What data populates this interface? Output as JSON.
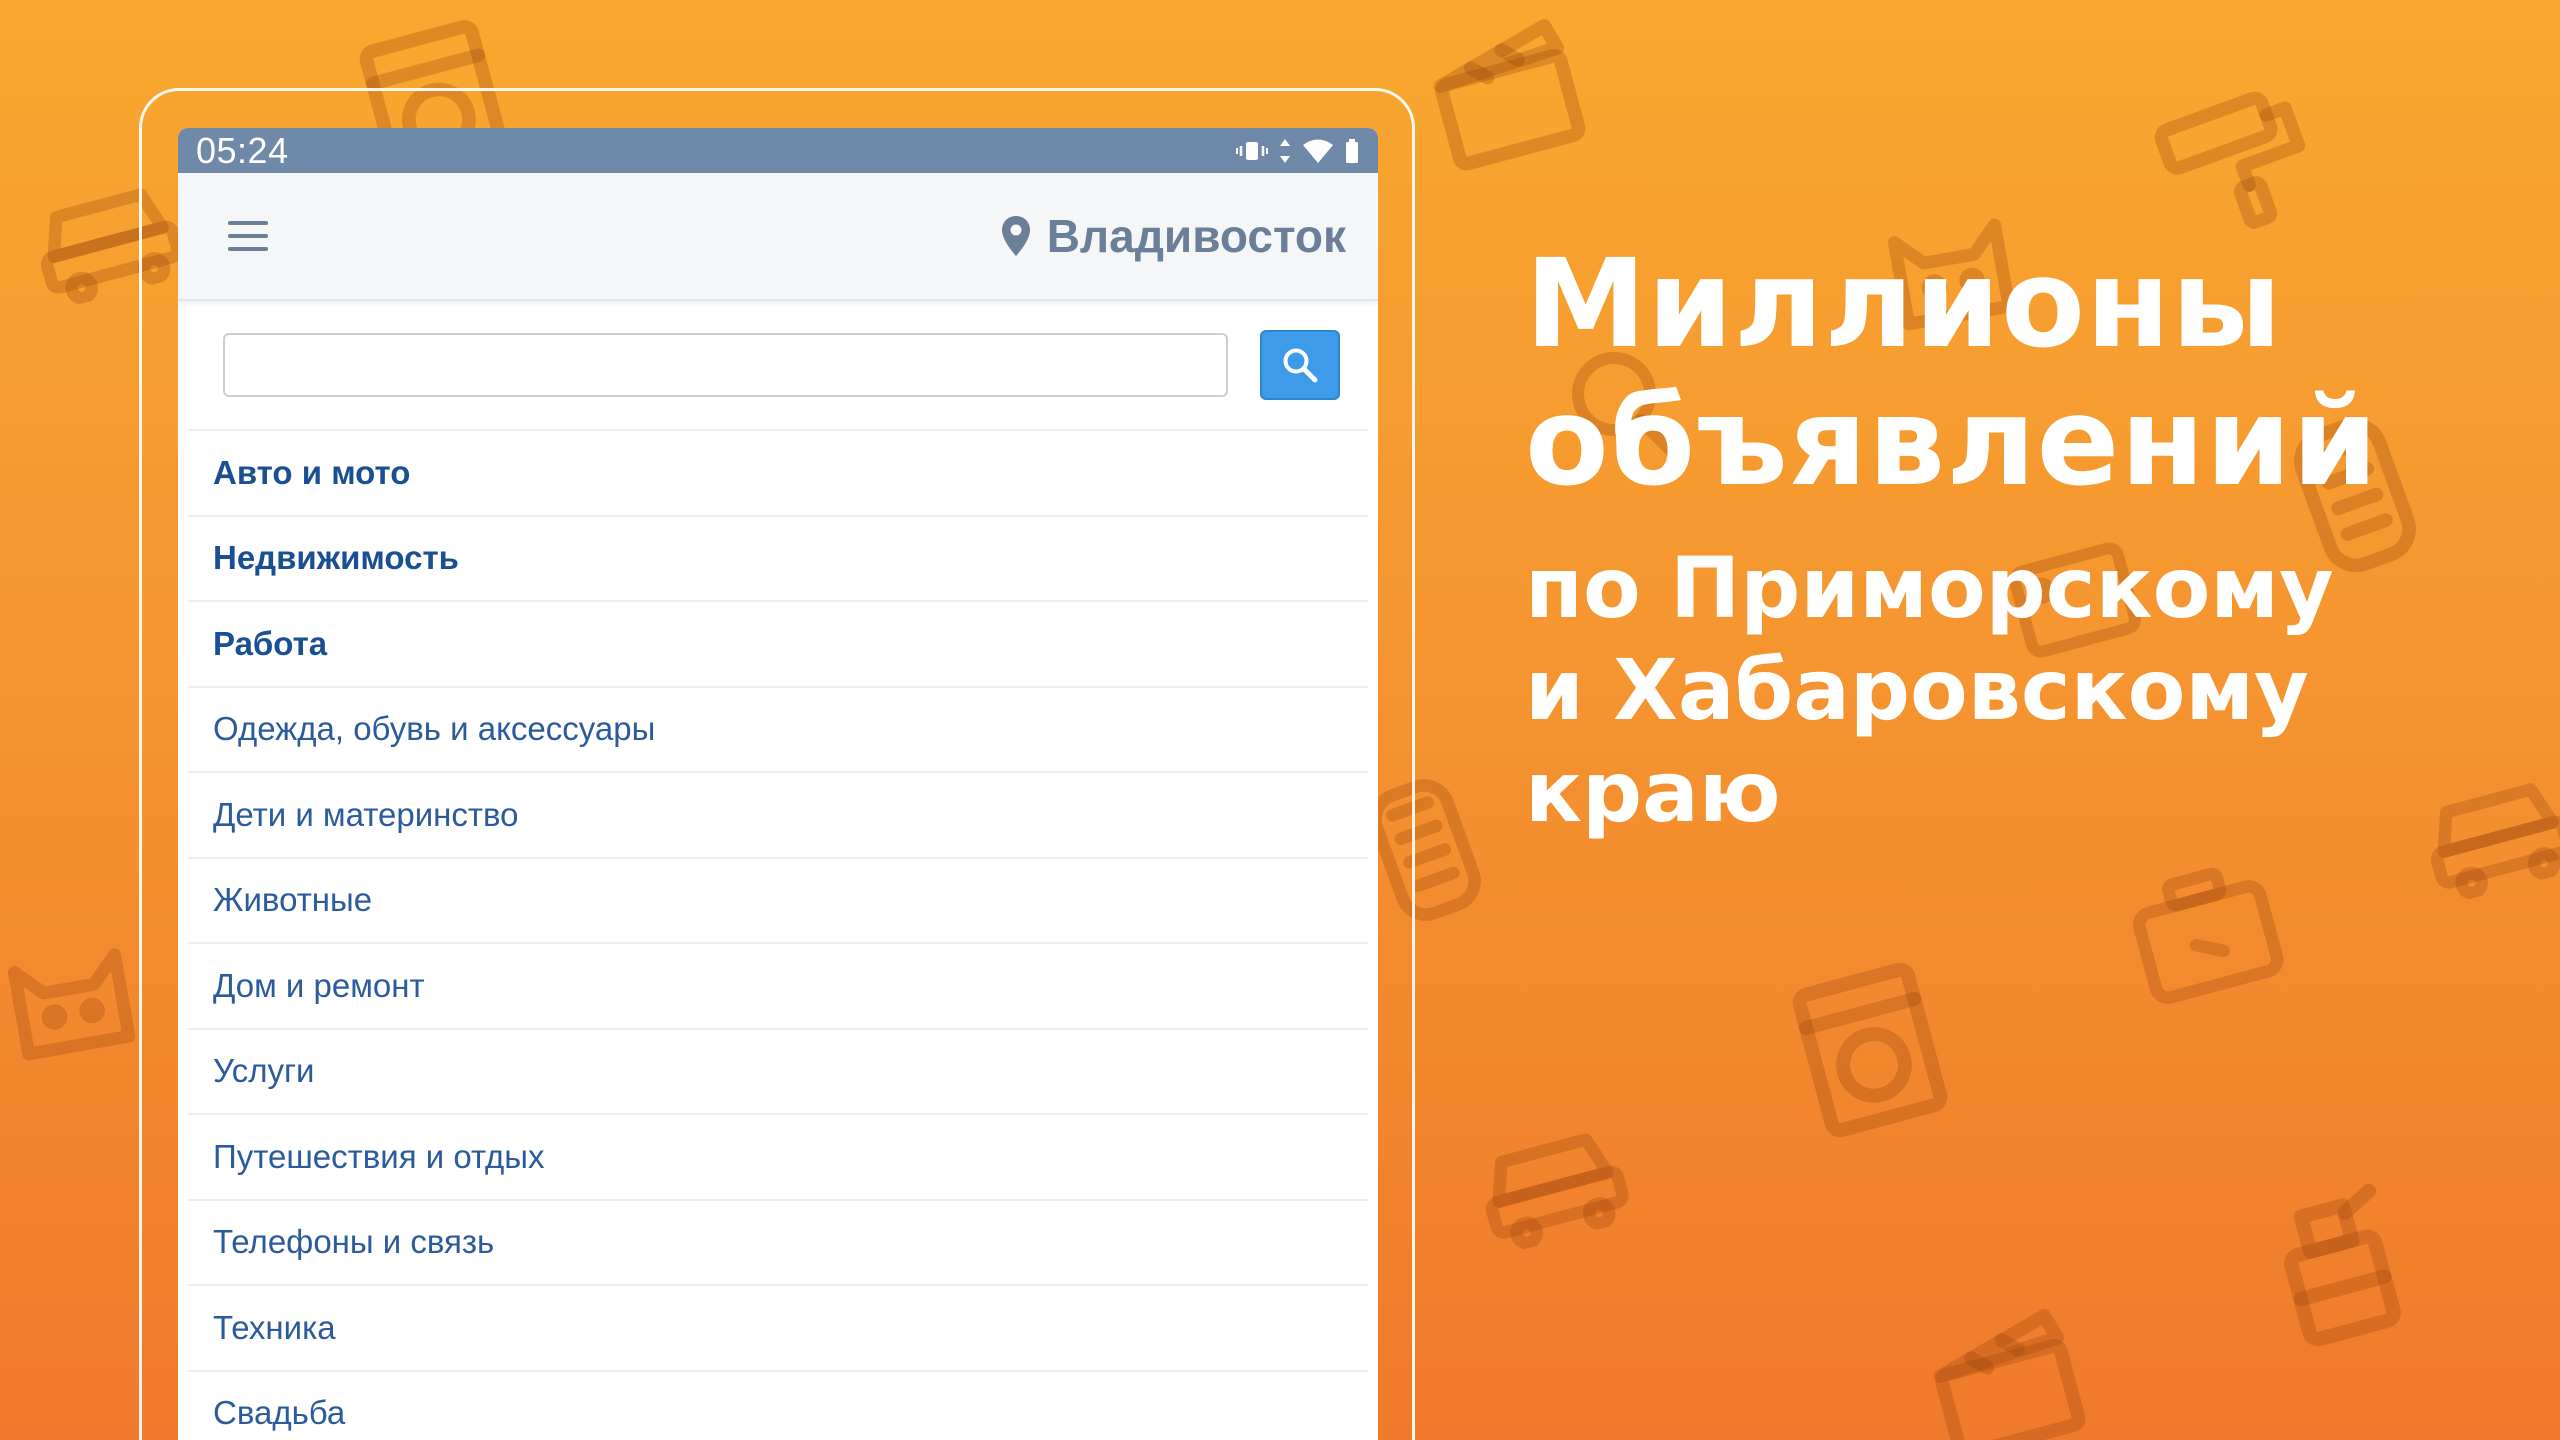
{
  "status_bar": {
    "time": "05:24",
    "icons": [
      "vibrate-icon",
      "data-arrows-icon",
      "wifi-icon",
      "battery-icon"
    ]
  },
  "app_bar": {
    "menu_icon": "hamburger-menu-icon",
    "location_icon": "map-pin-icon",
    "location": "Владивосток"
  },
  "search": {
    "value": "",
    "placeholder": "",
    "button_icon": "search-icon"
  },
  "categories": [
    {
      "label": "Авто и мото",
      "bold": true
    },
    {
      "label": "Недвижимость",
      "bold": true
    },
    {
      "label": "Работа",
      "bold": true
    },
    {
      "label": "Одежда, обувь и аксессуары",
      "bold": false
    },
    {
      "label": "Дети и материнство",
      "bold": false
    },
    {
      "label": "Животные",
      "bold": false
    },
    {
      "label": "Дом и ремонт",
      "bold": false
    },
    {
      "label": "Услуги",
      "bold": false
    },
    {
      "label": "Путешествия и отдых",
      "bold": false
    },
    {
      "label": "Телефоны и связь",
      "bold": false
    },
    {
      "label": "Техника",
      "bold": false
    },
    {
      "label": "Свадьба",
      "bold": false
    }
  ],
  "headline": {
    "title_line1": "Миллионы",
    "title_line2": "объявлений",
    "sub_line1": "по Приморскому",
    "sub_line2": "и Хабаровскому",
    "sub_line3": "краю"
  },
  "colors": {
    "background_top": "#f8a830",
    "background_bottom": "#f07a2b",
    "status_bar": "#6f89a8",
    "link_blue": "#1b4f93",
    "search_button": "#3d9be9"
  }
}
